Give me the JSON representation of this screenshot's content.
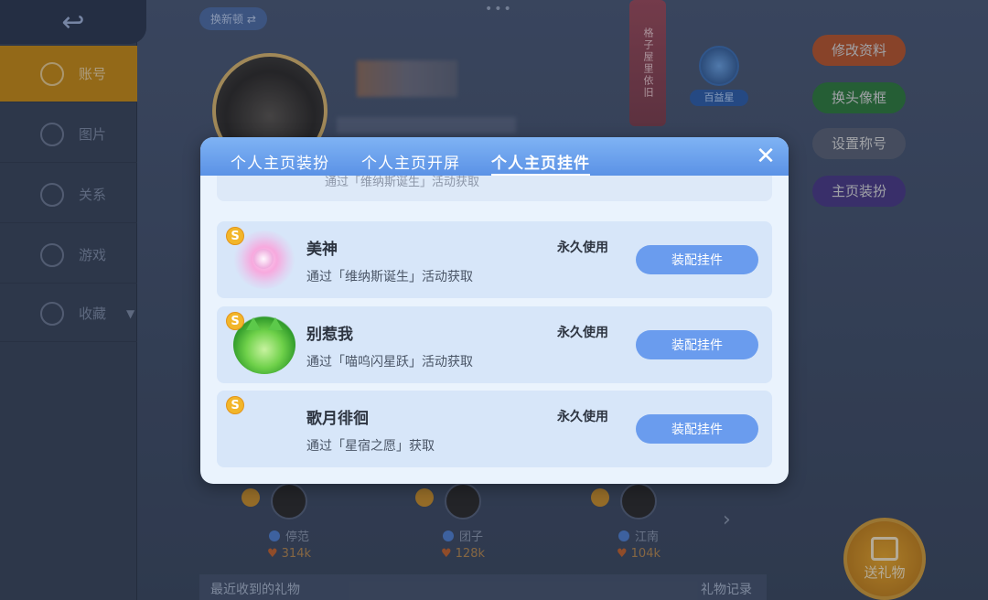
{
  "background": {
    "back_icon": "back-arrow-icon",
    "top_dots": "•••",
    "tag_chip": "换新顿 ⇄",
    "banner_text": "格子屋里依旧",
    "badge_label": "百益星",
    "sidebar": {
      "items": [
        {
          "label": "账号",
          "icon": "user-icon",
          "active": true
        },
        {
          "label": "图片",
          "icon": "image-icon"
        },
        {
          "label": "关系",
          "icon": "heart-icon"
        },
        {
          "label": "游戏",
          "icon": "game-icon"
        },
        {
          "label": "收藏",
          "icon": "star-icon",
          "caret": "▼"
        }
      ]
    },
    "right_buttons": [
      {
        "label": "修改资料",
        "color": "#b8552c"
      },
      {
        "label": "换头像框",
        "color": "#2f7a3c"
      },
      {
        "label": "设置称号",
        "color": "#5a6275"
      },
      {
        "label": "主页装扮",
        "color": "#4a3a86"
      }
    ],
    "fans": [
      {
        "name": "停范",
        "score": "314k"
      },
      {
        "name": "团子",
        "score": "128k"
      },
      {
        "name": "江南",
        "score": "104k"
      }
    ],
    "fans_next_icon": "chevron-right-icon",
    "gift_footer": {
      "title": "最近收到的礼物",
      "record": "礼物记录"
    },
    "send_gift": "送礼物"
  },
  "modal": {
    "tabs": [
      {
        "label": "个人主页装扮"
      },
      {
        "label": "个人主页开屏"
      },
      {
        "label": "个人主页挂件",
        "active": true
      }
    ],
    "close_icon": "close-icon",
    "partial_desc": "通过「维纳斯诞生」活动获取",
    "items": [
      {
        "badge": "S",
        "name": "美神",
        "desc": "通过「维纳斯诞生」活动获取",
        "duration": "永久使用",
        "action": "装配挂件",
        "icon": "goddess-pendant-icon"
      },
      {
        "badge": "S",
        "name": "别惹我",
        "desc": "通过「喵呜闪星跃」活动获取",
        "duration": "永久使用",
        "action": "装配挂件",
        "icon": "green-cat-pendant-icon"
      },
      {
        "badge": "S",
        "name": "歌月徘徊",
        "desc": "通过「星宿之愿」获取",
        "duration": "永久使用",
        "action": "装配挂件",
        "icon": "moon-pendant-icon"
      }
    ]
  }
}
